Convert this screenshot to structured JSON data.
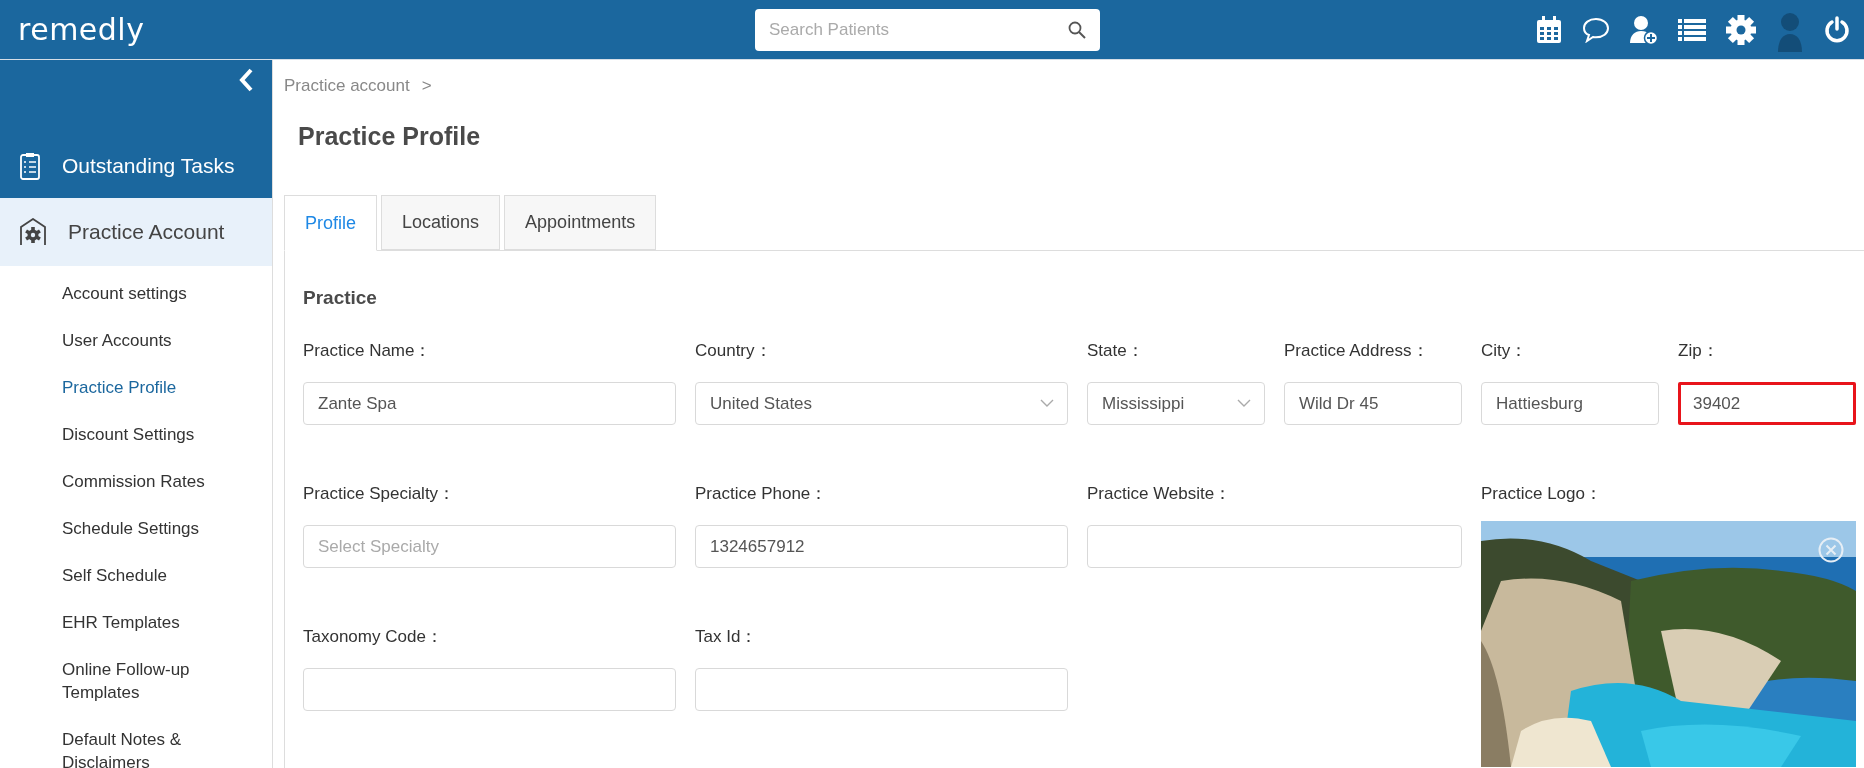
{
  "header": {
    "logo": "remedly",
    "search": {
      "placeholder": "Search Patients"
    }
  },
  "sidebar": {
    "sections": [
      {
        "label": "Outstanding Tasks",
        "kind": "tasks",
        "selected": false
      },
      {
        "label": "Practice Account",
        "kind": "account",
        "selected": true
      }
    ],
    "items": [
      {
        "label": "Account settings",
        "selected": false
      },
      {
        "label": "User Accounts",
        "selected": false
      },
      {
        "label": "Practice Profile",
        "selected": true
      },
      {
        "label": "Discount Settings",
        "selected": false
      },
      {
        "label": "Commission Rates",
        "selected": false
      },
      {
        "label": "Schedule Settings",
        "selected": false
      },
      {
        "label": "Self Schedule",
        "selected": false
      },
      {
        "label": "EHR Templates",
        "selected": false
      },
      {
        "label": "Online Follow-up Templates",
        "selected": false
      },
      {
        "label": "Default Notes & Disclaimers",
        "selected": false
      }
    ]
  },
  "breadcrumb": {
    "items": [
      "Practice account"
    ],
    "separator": ">"
  },
  "page_title": "Practice Profile",
  "tabs": [
    {
      "label": "Profile",
      "selected": true
    },
    {
      "label": "Locations",
      "selected": false
    },
    {
      "label": "Appointments",
      "selected": false
    }
  ],
  "section_title": "Practice",
  "fields": [
    {
      "label": "Practice Name：",
      "kind": "text",
      "value": "Zante Spa",
      "highlighted": false
    },
    {
      "label": "Country：",
      "kind": "select",
      "value": "United States",
      "highlighted": false
    },
    {
      "label": "State：",
      "kind": "select",
      "value": "Mississippi",
      "highlighted": false
    },
    {
      "label": "Practice Address：",
      "kind": "text",
      "value": "Wild Dr 45",
      "highlighted": false
    },
    {
      "label": "City：",
      "kind": "text",
      "value": "Hattiesburg",
      "highlighted": false
    },
    {
      "label": "Zip：",
      "kind": "text",
      "value": "39402",
      "highlighted": true
    },
    {
      "label": "Practice Specialty：",
      "kind": "text",
      "placeholder": "Select Specialty",
      "highlighted": false
    },
    {
      "label": "Practice Phone：",
      "kind": "text",
      "value": "1324657912",
      "highlighted": false
    },
    {
      "label": "Practice Website：",
      "kind": "text",
      "highlighted": false
    },
    {
      "label": "Practice Logo：",
      "kind": "picture"
    },
    {
      "label": "Taxonomy Code：",
      "kind": "text",
      "highlighted": false
    },
    {
      "label": "Tax Id：",
      "kind": "text",
      "highlighted": false
    }
  ]
}
